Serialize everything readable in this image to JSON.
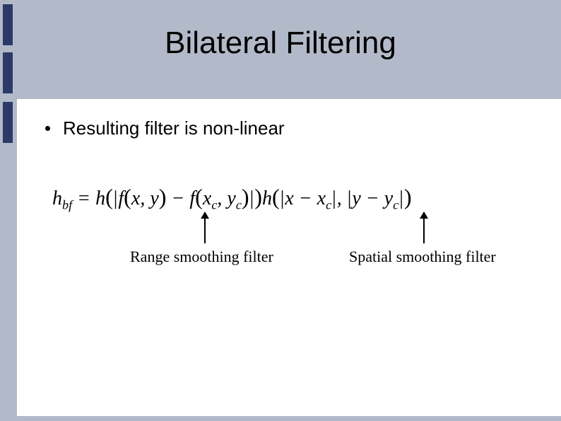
{
  "slide": {
    "title": "Bilateral Filtering",
    "bullet": "Resulting filter is non-linear",
    "formula": {
      "lhs_h": "h",
      "lhs_sub": "bf",
      "eq": " = ",
      "h1": "h",
      "abs_open": "|",
      "f1": "f",
      "xy_open": "(",
      "x": "x",
      "comma": ", ",
      "y": "y",
      "xy_close": ")",
      "minus": " − ",
      "f2": "f",
      "xc": "x",
      "c": "c",
      "yc": "y",
      "abs_close": "|",
      "h2": "h"
    },
    "captions": {
      "range": "Range smoothing filter",
      "spatial": "Spatial smoothing filter"
    }
  }
}
